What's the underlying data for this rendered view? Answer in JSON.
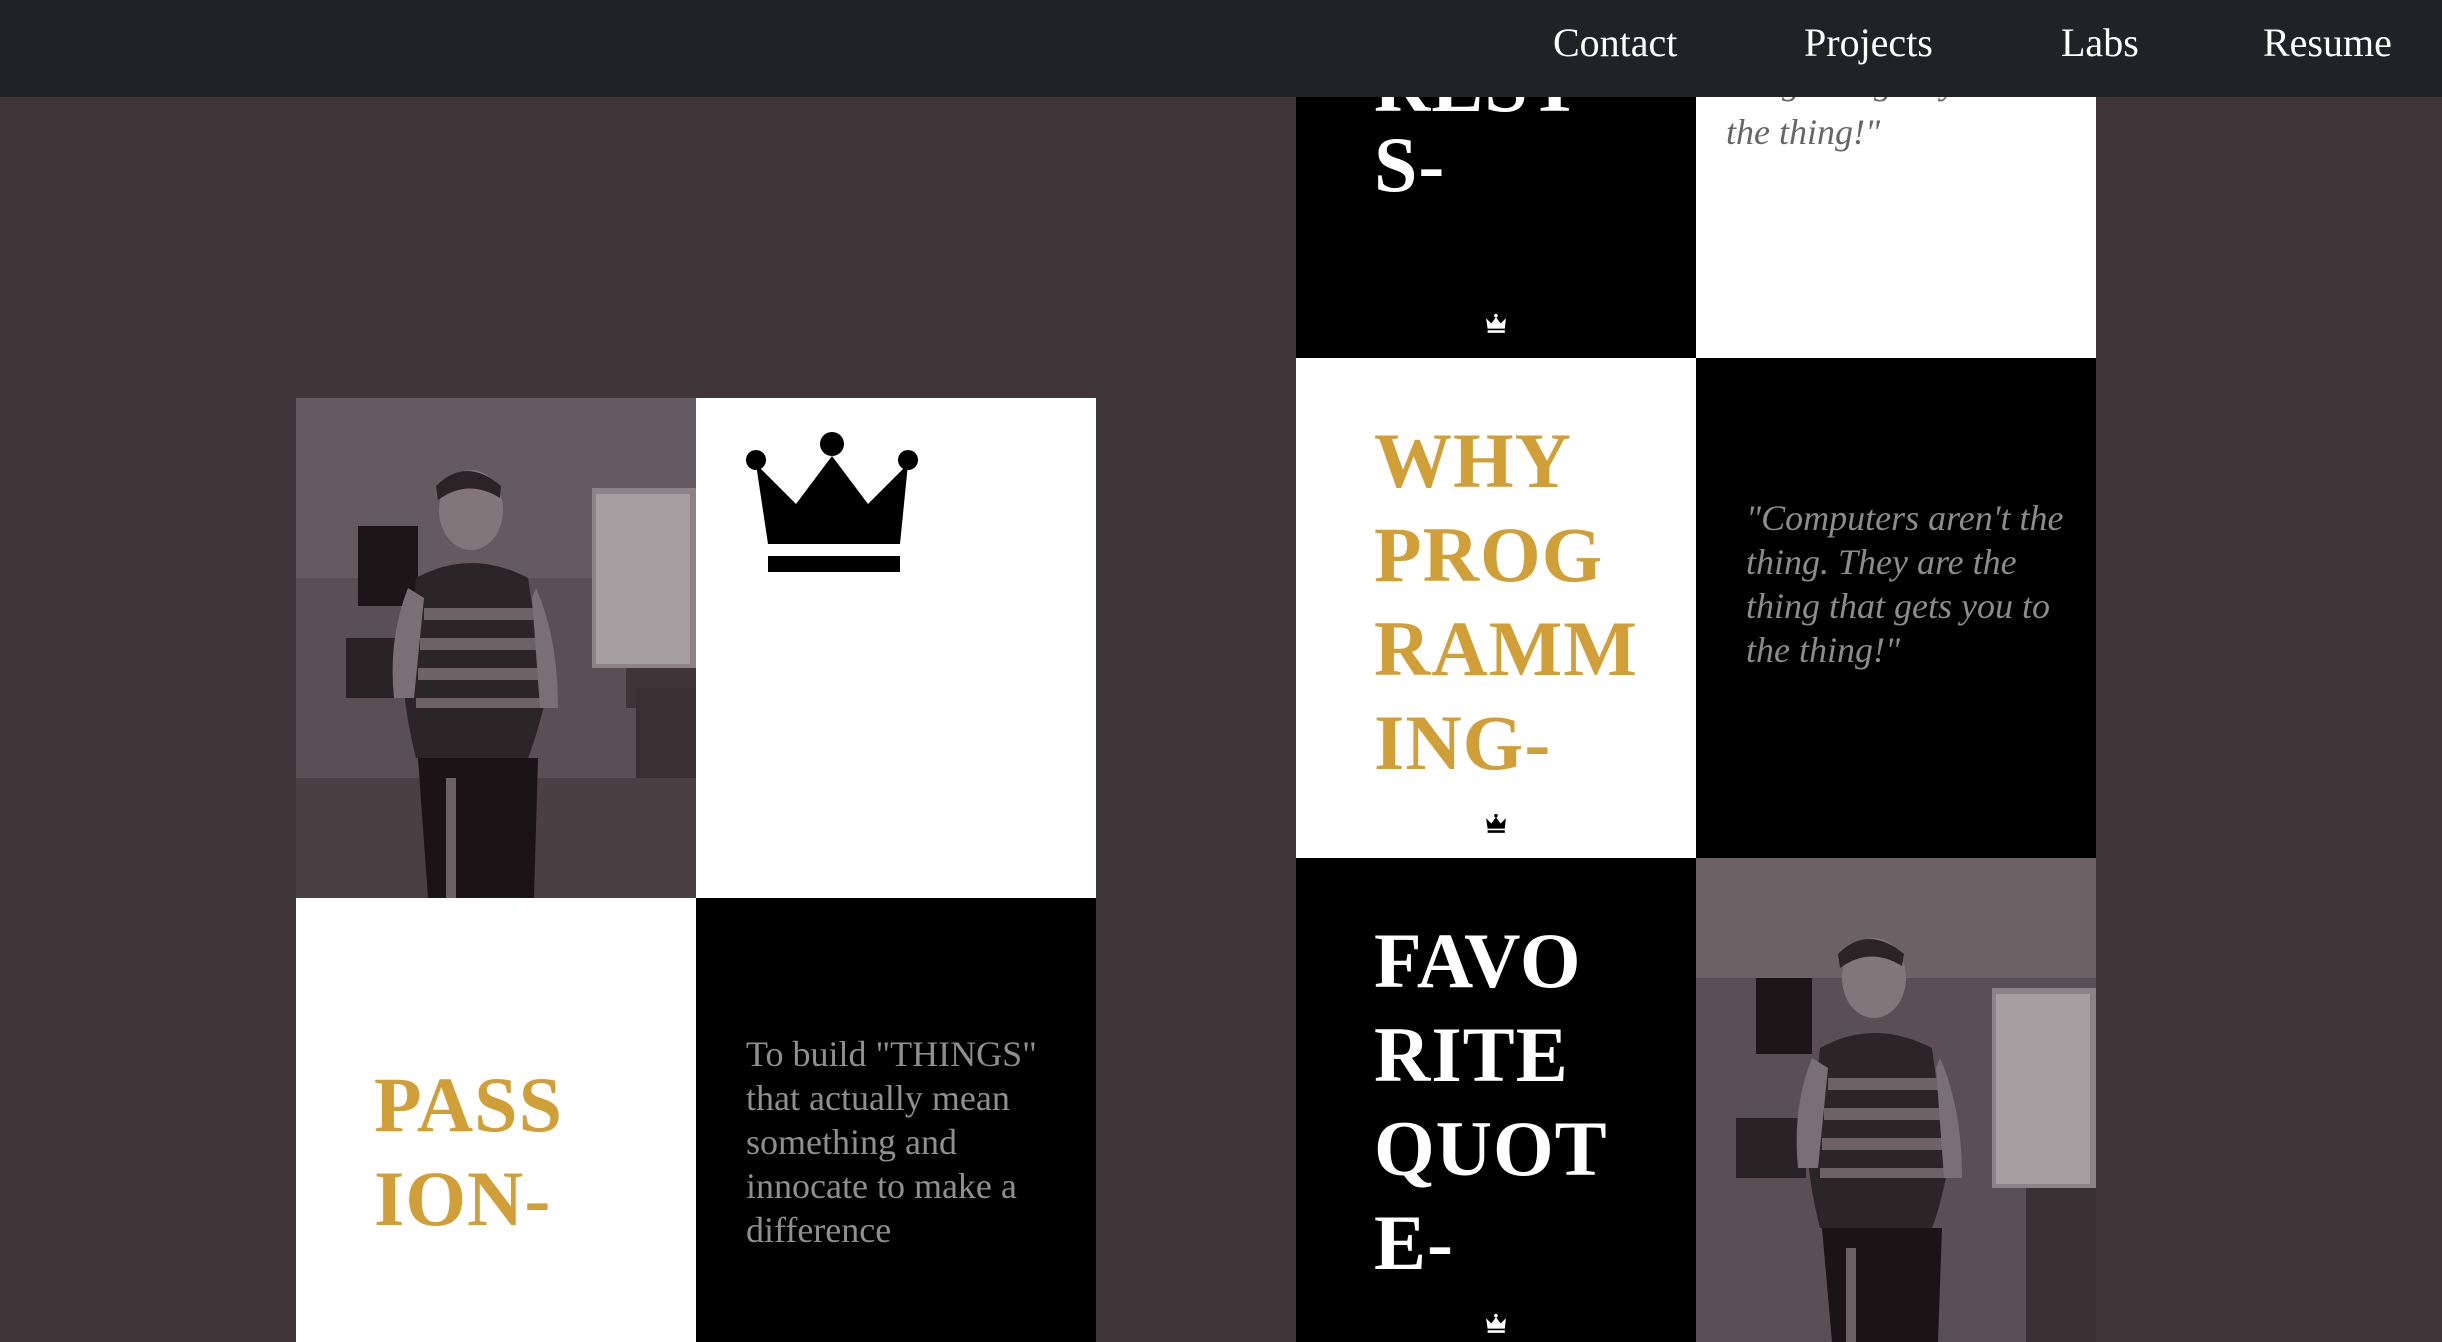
{
  "nav": {
    "links": [
      "Contact",
      "Projects",
      "Labs",
      "Resume"
    ]
  },
  "tiles": {
    "interests": {
      "heading_partial": "REST",
      "heading_end": "S-"
    },
    "quote_top": {
      "text_partial": "thing that gets you to",
      "text_end": "the thing!\""
    },
    "why_programming": {
      "heading": "WHY\nPROG\nRAMM\nING-"
    },
    "why_quote": {
      "text": "\"Computers aren't the thing. They are the thing that gets you to the thing!\""
    },
    "favorite_quote": {
      "heading": "FAVO\nRITE\nQUOT\nE-"
    },
    "passion": {
      "heading": "PASS\nION-"
    },
    "passion_text": {
      "text": "To build \"THINGS\" that actually mean something and innocate to make a difference"
    }
  },
  "colors": {
    "page_bg": "#3f3438",
    "navbar_bg": "#212224",
    "accent_gold": "#d19f37",
    "quote_grey": "#8c8c8c"
  },
  "icons": {
    "crown": "crown-icon",
    "photo": "portrait-photo"
  }
}
